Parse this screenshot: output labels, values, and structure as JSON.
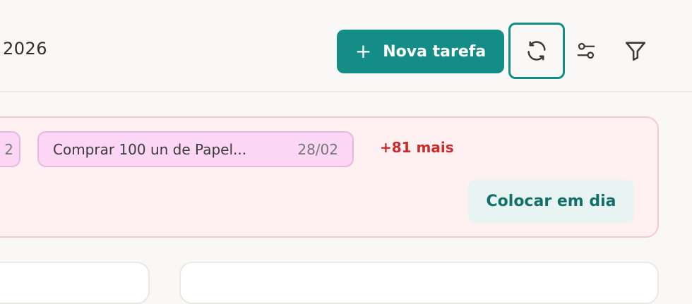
{
  "header": {
    "date_text": "2026",
    "new_task_label": "Nova tarefa"
  },
  "icons": {
    "plus": "plus-icon",
    "refresh": "refresh-icon",
    "sliders": "sliders-icon",
    "filter": "filter-icon"
  },
  "overdue": {
    "prev_chip_date": "2",
    "chip_title": "Comprar 100 un de Papel...",
    "chip_date": "28/02",
    "more_label": "+81 mais",
    "catchup_label": "Colocar em dia"
  },
  "colors": {
    "primary": "#148d86",
    "alert_bg": "#fff1f1",
    "alert_border": "#f5c9c9",
    "chip_bg": "#fcd6f5",
    "more_red": "#cc2b2b"
  }
}
